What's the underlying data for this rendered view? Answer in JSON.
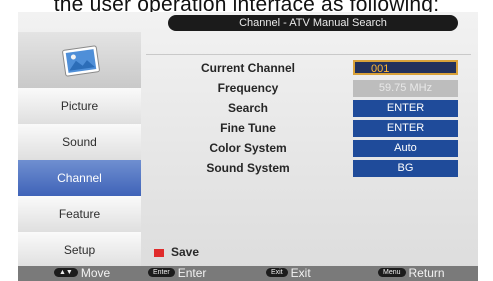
{
  "caption": "the user operation interface as following:",
  "title": "Channel - ATV Manual Search",
  "sidebar": {
    "items": [
      {
        "label": "Picture"
      },
      {
        "label": "Sound"
      },
      {
        "label": "Channel",
        "active": true
      },
      {
        "label": "Feature"
      },
      {
        "label": "Setup"
      }
    ]
  },
  "settings": [
    {
      "label": "Current Channel",
      "value": "001"
    },
    {
      "label": "Frequency",
      "value": "59.75 MHz"
    },
    {
      "label": "Search",
      "value": "ENTER"
    },
    {
      "label": "Fine Tune",
      "value": "ENTER"
    },
    {
      "label": "Color System",
      "value": "Auto"
    },
    {
      "label": "Sound System",
      "value": "BG"
    }
  ],
  "save_label": "Save",
  "footer": [
    {
      "key": "▲▼",
      "label": "Move"
    },
    {
      "key": "Enter",
      "label": "Enter"
    },
    {
      "key": "Exit",
      "label": "Exit"
    },
    {
      "key": "Menu",
      "label": "Return"
    }
  ],
  "colors": {
    "accent_blue": "#1f4b9a",
    "active_tab": "#4f6fc0",
    "selection_border": "#d9a23a",
    "save_marker": "#e02b2b"
  }
}
